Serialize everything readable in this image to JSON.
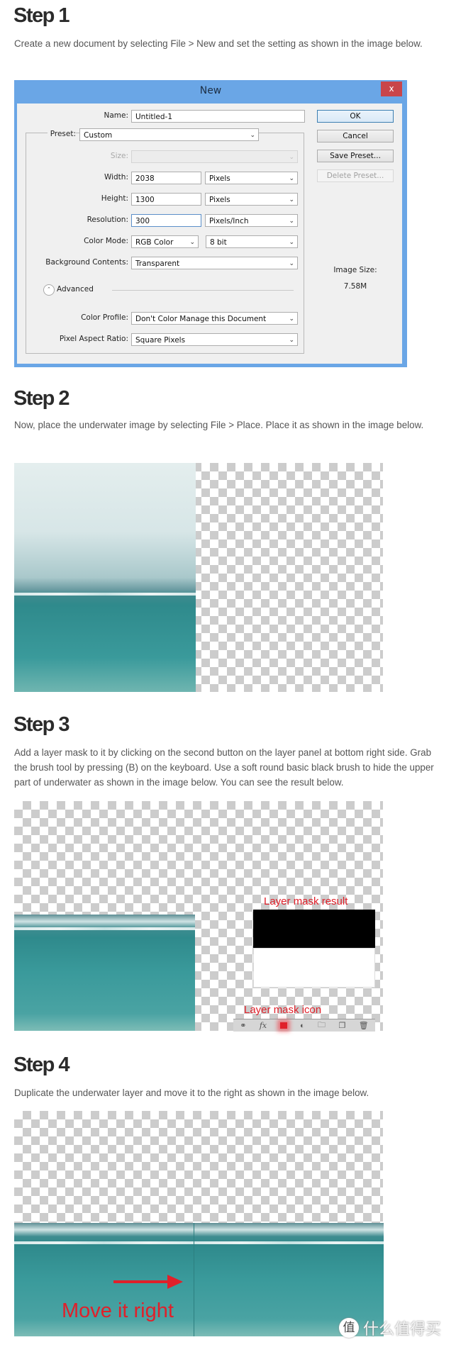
{
  "steps": [
    {
      "heading": "Step 1",
      "text": "Create a new document by selecting File > New and set the setting as shown in the image below."
    },
    {
      "heading": "Step 2",
      "text": "Now, place the underwater image by selecting File > Place. Place it as shown in the image below."
    },
    {
      "heading": "Step 3",
      "text": "Add a layer mask to it by clicking on the second button on the layer panel at bottom right side. Grab the brush tool by pressing (B) on the keyboard. Use a soft round basic black brush to hide the upper part of underwater as shown in the image below. You can see the result below."
    },
    {
      "heading": "Step 4",
      "text": "Duplicate the underwater layer and move it to the right as shown in the image below."
    }
  ],
  "dialog": {
    "title": "New",
    "close": "x",
    "name_label": "Name:",
    "name_value": "Untitled-1",
    "preset_label": "Preset:",
    "preset_value": "Custom",
    "size_label": "Size:",
    "width_label": "Width:",
    "width_value": "2038",
    "width_unit": "Pixels",
    "height_label": "Height:",
    "height_value": "1300",
    "height_unit": "Pixels",
    "resolution_label": "Resolution:",
    "resolution_value": "300",
    "resolution_unit": "Pixels/Inch",
    "color_mode_label": "Color Mode:",
    "color_mode_value": "RGB Color",
    "bit_depth": "8 bit",
    "bg_label": "Background Contents:",
    "bg_value": "Transparent",
    "advanced_label": "Advanced",
    "profile_label": "Color Profile:",
    "profile_value": "Don't Color Manage this Document",
    "par_label": "Pixel Aspect Ratio:",
    "par_value": "Square Pixels",
    "ok": "OK",
    "cancel": "Cancel",
    "save_preset": "Save Preset...",
    "delete_preset": "Delete Preset...",
    "image_size_label": "Image Size:",
    "image_size_value": "7.58M",
    "title_bar_color": "#6aa6e6",
    "close_color": "#c9454a"
  },
  "step3_image": {
    "mask_result_label": "Layer mask result",
    "mask_icon_label": "Layer mask icon",
    "toolbar_icons": [
      "link-icon",
      "fx-icon",
      "layer-mask-icon",
      "adjustment-icon",
      "folder-icon",
      "new-layer-icon",
      "trash-icon"
    ]
  },
  "step4_image": {
    "annotation": "Move it right",
    "annotation_color": "#e0202a"
  },
  "watermark": {
    "badge": "值",
    "text": "什么值得买"
  }
}
